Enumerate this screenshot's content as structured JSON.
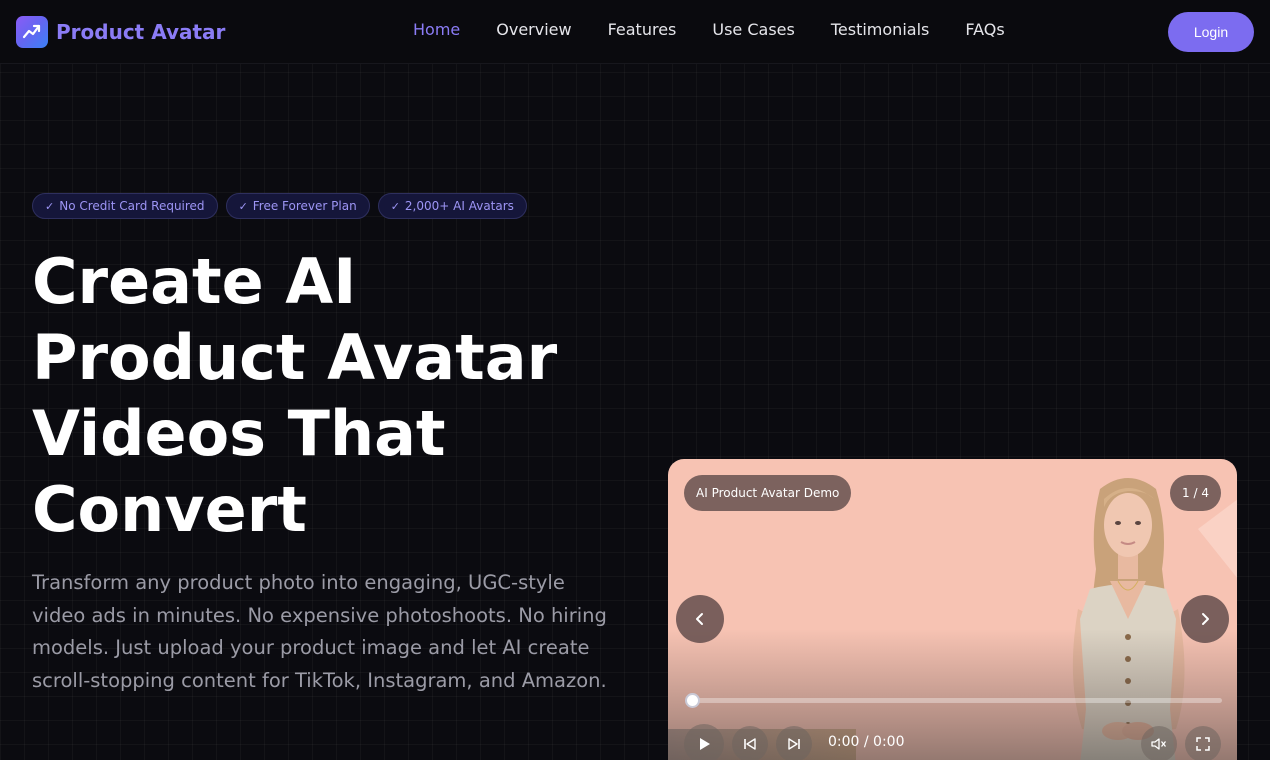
{
  "brand": {
    "name": "Product Avatar"
  },
  "nav": {
    "links": [
      {
        "label": "Home",
        "active": true
      },
      {
        "label": "Overview"
      },
      {
        "label": "Features"
      },
      {
        "label": "Use Cases"
      },
      {
        "label": "Testimonials"
      },
      {
        "label": "FAQs"
      }
    ],
    "login_label": "Login"
  },
  "hero": {
    "badges": [
      "No Credit Card Required",
      "Free Forever Plan",
      "2,000+ AI Avatars"
    ],
    "headline_lines": [
      "Create AI",
      "Product Avatar",
      "Videos That",
      "Convert"
    ],
    "subtext": "Transform any product photo into engaging, UGC-style video ads in minutes. No expensive photoshoots. No hiring models. Just upload your product image and let AI create scroll-stopping content for TikTok, Instagram, and Amazon."
  },
  "video": {
    "label": "AI Product Avatar Demo",
    "counter": "1 / 4",
    "time": "0:00 / 0:00",
    "progress": 0
  },
  "colors": {
    "accent": "#7c6cf0",
    "brand_text": "#8b7cf6",
    "background": "#0b0b10",
    "video_bg": "#f7c3b3"
  },
  "icons": {
    "logo": "trending-up-chart-icon",
    "badge": "check-icon",
    "prev": "chevron-left-icon",
    "next": "chevron-right-icon",
    "play": "play-icon",
    "skip_back": "skip-back-icon",
    "skip_forward": "skip-forward-icon",
    "mute": "volume-mute-icon",
    "fullscreen": "fullscreen-icon"
  }
}
